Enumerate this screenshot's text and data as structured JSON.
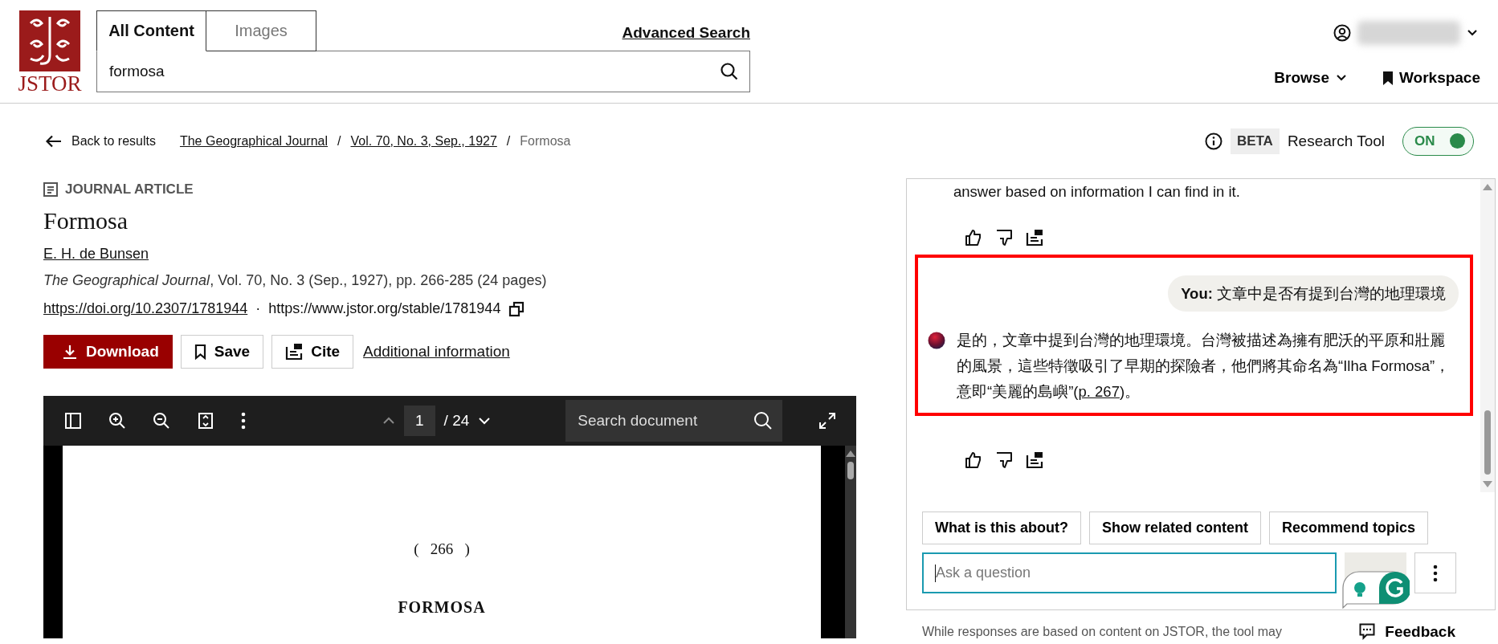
{
  "header": {
    "logo_text": "JSTOR",
    "search_tabs": [
      {
        "label": "All Content",
        "selected": true
      },
      {
        "label": "Images",
        "selected": false
      }
    ],
    "search": {
      "value": "formosa"
    },
    "advanced_search": "Advanced Search",
    "nav": [
      {
        "label": "Browse",
        "kind": "dropdown"
      },
      {
        "label": "Workspace",
        "kind": "bookmark"
      }
    ]
  },
  "breadcrumb": {
    "back": "Back to results",
    "separator": "/",
    "items": [
      {
        "label": "The Geographical Journal",
        "link": true
      },
      {
        "label": "Vol. 70, No. 3, Sep., 1927",
        "link": true
      },
      {
        "label": "Formosa",
        "link": false
      }
    ]
  },
  "research_tool": {
    "beta": "BETA",
    "label": "Research Tool",
    "toggle": {
      "label": "ON",
      "on": true
    }
  },
  "article": {
    "type": "JOURNAL ARTICLE",
    "title": "Formosa",
    "author": "E. H. de Bunsen",
    "citation": "*The Geographical Journal*, Vol. 70, No. 3 (Sep., 1927), pp. 266-285 (24 pages)",
    "doi": "https://doi.org/10.2307/1781944",
    "separator": "·",
    "stable_url": "https://www.jstor.org/stable/1781944",
    "buttons": [
      {
        "label": "Download",
        "kind": "primary"
      },
      {
        "label": "Save",
        "kind": "save"
      },
      {
        "label": "Cite",
        "kind": "cite"
      }
    ],
    "additional": "Additional information"
  },
  "viewer": {
    "page": "1",
    "total": "/ 24",
    "search_placeholder": "Search document",
    "page_number": "(   266   )",
    "page_title": "FORMOSA"
  },
  "chat": {
    "sections": [
      {
        "highlighted": false,
        "items": [
          {
            "kind": "bot",
            "avatar": false,
            "parts": [
              {
                "kind": "text",
                "text": "answer based on information I can find in it."
              }
            ]
          },
          {
            "kind": "actions"
          }
        ]
      },
      {
        "highlighted": true,
        "items": [
          {
            "kind": "user",
            "speaker": "You:",
            "text": "文章中是否有提到台灣的地理環境"
          },
          {
            "kind": "bot",
            "avatar": true,
            "parts": [
              {
                "kind": "text",
                "text": "是的，文章中提到台灣的地理環境。台灣被描述為擁有肥沃的平原和壯麗的風景，這些特徵吸引了早期的探險者，他們將其命名為“Ilha Formosa”，意即“美麗的島嶼”("
              },
              {
                "kind": "link",
                "text": "p. 267"
              },
              {
                "kind": "text",
                "text": ")。"
              }
            ]
          }
        ]
      },
      {
        "highlighted": false,
        "items": [
          {
            "kind": "actions"
          }
        ]
      }
    ],
    "suggestions": [
      "What is this about?",
      "Show related content",
      "Recommend topics"
    ],
    "input": {
      "placeholder": "Ask a question"
    },
    "disclaimer": "While responses are based on content on JSTOR, the tool may",
    "feedback": "Feedback"
  }
}
